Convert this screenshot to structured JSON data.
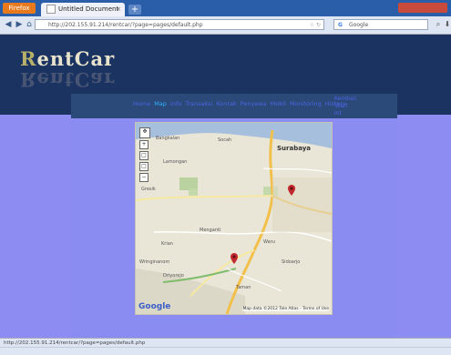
{
  "browser": {
    "app_button": "Firefox",
    "tab_title": "Untitled Document",
    "newtab_symbol": "+",
    "url": "http://202.155.91.214/rentcar/?page=pages/default.php",
    "search_placeholder": "Google",
    "status_url": "http://202.155.91.214/rentcar/?page=pages/default.php"
  },
  "site": {
    "logo": "RentCar",
    "logo_first": "R",
    "logo_rest": "entCar",
    "nav": [
      "Home",
      "Map",
      "Info",
      "Transaksi",
      "Kontak",
      "Penyewa",
      "Mobil",
      "Monitoring",
      "History"
    ],
    "nav_active": "Map",
    "nav_extra": "Kembali\nStart Int"
  },
  "map": {
    "city_main": "Surabaya",
    "labels": [
      "Bangkalan",
      "Socah",
      "Lamongan",
      "Gresik",
      "Menganti",
      "Sidoarjo",
      "Krian",
      "Waru",
      "Driyorejo",
      "Taman",
      "Wringinanom"
    ],
    "google": "Google",
    "attribution": "Map data ©2012 Tele Atlas - Terms of Use",
    "zoom_in": "+",
    "zoom_out": "−",
    "zoom_levels": [
      "+",
      "□",
      "□",
      "−"
    ],
    "pan_symbol": "✥"
  },
  "colors": {
    "page_bg": "#8c8cf2",
    "header_bg": "#1b3360",
    "navbar_bg": "#2c4a79",
    "nav_link": "#4a64e2",
    "nav_active": "#2eb0ff",
    "pin": "#c0282d"
  },
  "icons": {
    "back": "back-arrow-icon",
    "forward": "forward-arrow-icon",
    "home": "home-icon",
    "search": "search-icon",
    "pin": "map-pin-icon"
  }
}
